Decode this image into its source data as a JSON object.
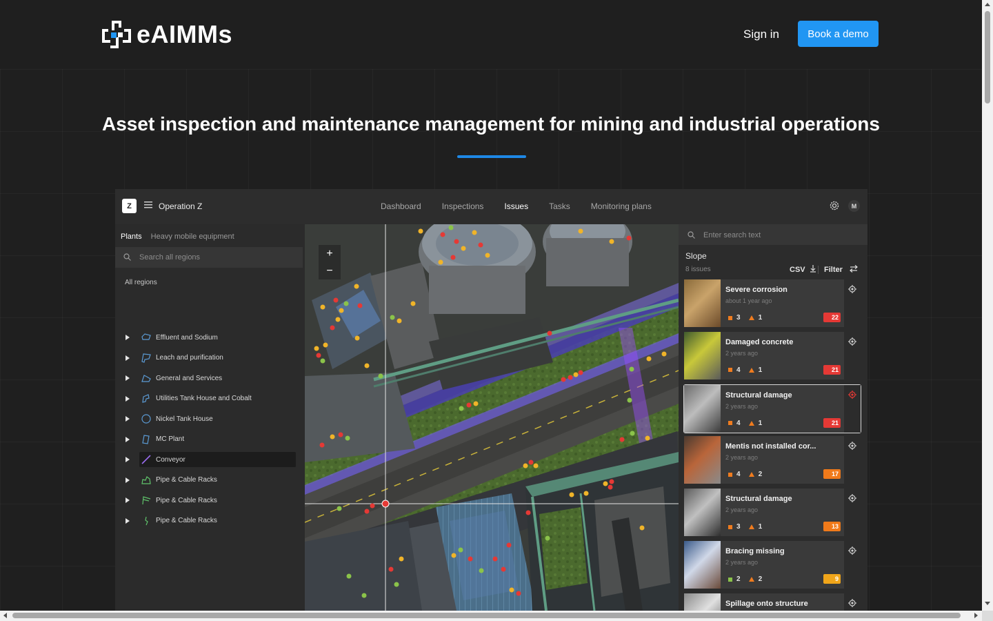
{
  "header": {
    "logo_text": "eAIMMs",
    "sign_in": "Sign in",
    "book_demo": "Book a demo"
  },
  "hero": {
    "title": "Asset inspection and maintenance management for mining and industrial operations"
  },
  "app": {
    "org_badge": "Z",
    "org_name": "Operation Z",
    "nav": [
      "Dashboard",
      "Inspections",
      "Issues",
      "Tasks",
      "Monitoring plans"
    ],
    "active_nav": "Issues",
    "avatar": "M",
    "left_panel": {
      "tabs": [
        "Plants",
        "Heavy mobile equipment"
      ],
      "search_placeholder": "Search all regions",
      "all_regions": "All regions",
      "regions": [
        {
          "label": "Effluent and Sodium",
          "icon": "effluent-region-icon",
          "color": "#5b9bd5"
        },
        {
          "label": "Leach and purification",
          "icon": "leach-region-icon",
          "color": "#5b9bd5"
        },
        {
          "label": "General and Services",
          "icon": "general-region-icon",
          "color": "#5b9bd5"
        },
        {
          "label": "Utilities Tank House and Cobalt",
          "icon": "utilities-region-icon",
          "color": "#5b9bd5"
        },
        {
          "label": "Nickel Tank House",
          "icon": "circle-region-icon",
          "color": "#5b9bd5"
        },
        {
          "label": "MC Plant",
          "icon": "mc-plant-region-icon",
          "color": "#5b9bd5"
        },
        {
          "label": "Conveyor",
          "icon": "conveyor-line-icon",
          "color": "#9b6cf0",
          "selected": true
        },
        {
          "label": "Pipe & Cable Racks",
          "icon": "pipe-rack-icon",
          "color": "#5fc36b"
        },
        {
          "label": "Pipe & Cable Racks",
          "icon": "pipe-rack-branch-icon",
          "color": "#5fc36b"
        },
        {
          "label": "Pipe & Cable Racks",
          "icon": "pipe-rack-line-icon",
          "color": "#5fc36b"
        }
      ]
    },
    "map": {
      "zoom_in": "+",
      "zoom_out": "−"
    },
    "right_panel": {
      "search_placeholder": "Enter search text",
      "title": "Slope",
      "count": "8 issues",
      "csv": "CSV",
      "filter": "Filter",
      "issues": [
        {
          "name": "Severe corrosion",
          "time": "about 1 year ago",
          "square_count": "3",
          "tri_count": "1",
          "badge": "22",
          "badge_color": "#e53935",
          "square_color": "#ef7c1f",
          "thumb": [
            "#8a6a3a",
            "#c9a36a",
            "#6b4a2a"
          ]
        },
        {
          "name": "Damaged concrete",
          "time": "2 years ago",
          "square_count": "4",
          "tri_count": "1",
          "badge": "21",
          "badge_color": "#e53935",
          "square_color": "#ef7c1f",
          "thumb": [
            "#3f5a2e",
            "#c8c83a",
            "#5a5a5a"
          ]
        },
        {
          "name": "Structural damage",
          "time": "2 years ago",
          "square_count": "4",
          "tri_count": "1",
          "badge": "21",
          "badge_color": "#e53935",
          "square_color": "#ef7c1f",
          "thumb": [
            "#6a6a6a",
            "#bdbdbd",
            "#3a3a3a"
          ],
          "selected": true
        },
        {
          "name": "Mentis not installed cor...",
          "time": "2 years ago",
          "square_count": "4",
          "tri_count": "2",
          "badge": "17",
          "badge_color": "#f07a1a",
          "square_color": "#ef7c1f",
          "thumb": [
            "#4a3a30",
            "#b9653a",
            "#8a8a8a"
          ]
        },
        {
          "name": "Structural damage",
          "time": "2 years ago",
          "square_count": "3",
          "tri_count": "1",
          "badge": "13",
          "badge_color": "#f07a1a",
          "square_color": "#ef7c1f",
          "thumb": [
            "#5a5a5a",
            "#c0c0c0",
            "#2e2e2e"
          ]
        },
        {
          "name": "Bracing missing",
          "time": "2 years ago",
          "square_count": "2",
          "tri_count": "2",
          "badge": "9",
          "badge_color": "#f0a51a",
          "square_color": "#8bc34a",
          "thumb": [
            "#3a5a8a",
            "#d0d8e8",
            "#6a4a3a"
          ]
        },
        {
          "name": "Spillage onto structure",
          "time": "",
          "square_count": "",
          "tri_count": "",
          "badge": "",
          "badge_color": "#f0a51a",
          "square_color": "#8bc34a",
          "thumb": [
            "#8a8a8a",
            "#e0e0e0",
            "#4a4a4a"
          ]
        }
      ]
    }
  }
}
